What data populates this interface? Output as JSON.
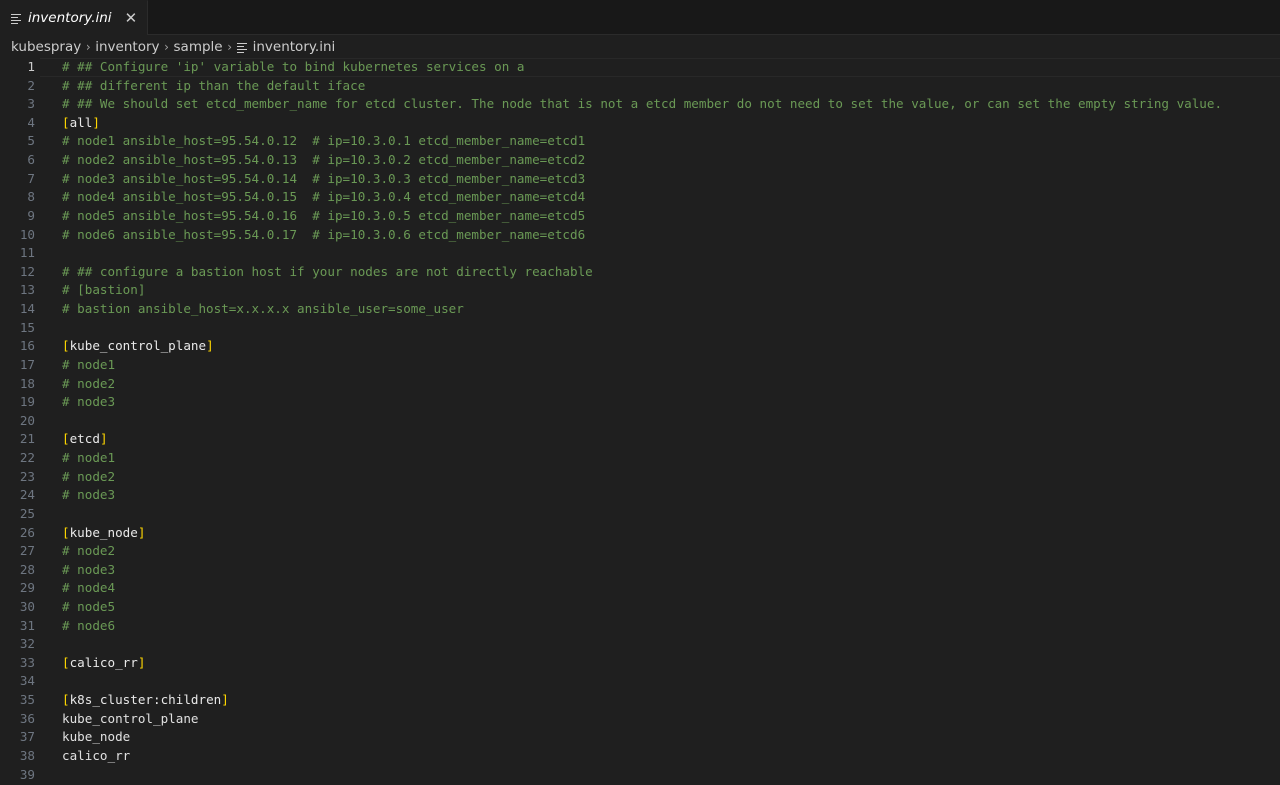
{
  "tab": {
    "label": "inventory.ini",
    "close": "✕",
    "icon": "file-lines-icon"
  },
  "breadcrumb": [
    "kubespray",
    "inventory",
    "sample",
    "inventory.ini"
  ],
  "lines": [
    {
      "n": "1",
      "kind": "comment",
      "text": "# ## Configure 'ip' variable to bind kubernetes services on a"
    },
    {
      "n": "2",
      "kind": "comment",
      "text": "# ## different ip than the default iface"
    },
    {
      "n": "3",
      "kind": "comment",
      "text": "# ## We should set etcd_member_name for etcd cluster. The node that is not a etcd member do not need to set the value, or can set the empty string value."
    },
    {
      "n": "4",
      "kind": "section",
      "text": "all"
    },
    {
      "n": "5",
      "kind": "comment",
      "text": "# node1 ansible_host=95.54.0.12  # ip=10.3.0.1 etcd_member_name=etcd1"
    },
    {
      "n": "6",
      "kind": "comment",
      "text": "# node2 ansible_host=95.54.0.13  # ip=10.3.0.2 etcd_member_name=etcd2"
    },
    {
      "n": "7",
      "kind": "comment",
      "text": "# node3 ansible_host=95.54.0.14  # ip=10.3.0.3 etcd_member_name=etcd3"
    },
    {
      "n": "8",
      "kind": "comment",
      "text": "# node4 ansible_host=95.54.0.15  # ip=10.3.0.4 etcd_member_name=etcd4"
    },
    {
      "n": "9",
      "kind": "comment",
      "text": "# node5 ansible_host=95.54.0.16  # ip=10.3.0.5 etcd_member_name=etcd5"
    },
    {
      "n": "10",
      "kind": "comment",
      "text": "# node6 ansible_host=95.54.0.17  # ip=10.3.0.6 etcd_member_name=etcd6"
    },
    {
      "n": "11",
      "kind": "blank",
      "text": ""
    },
    {
      "n": "12",
      "kind": "comment",
      "text": "# ## configure a bastion host if your nodes are not directly reachable"
    },
    {
      "n": "13",
      "kind": "comment",
      "text": "# [bastion]"
    },
    {
      "n": "14",
      "kind": "comment",
      "text": "# bastion ansible_host=x.x.x.x ansible_user=some_user"
    },
    {
      "n": "15",
      "kind": "blank",
      "text": ""
    },
    {
      "n": "16",
      "kind": "section",
      "text": "kube_control_plane"
    },
    {
      "n": "17",
      "kind": "comment",
      "text": "# node1"
    },
    {
      "n": "18",
      "kind": "comment",
      "text": "# node2"
    },
    {
      "n": "19",
      "kind": "comment",
      "text": "# node3"
    },
    {
      "n": "20",
      "kind": "blank",
      "text": ""
    },
    {
      "n": "21",
      "kind": "section",
      "text": "etcd"
    },
    {
      "n": "22",
      "kind": "comment",
      "text": "# node1"
    },
    {
      "n": "23",
      "kind": "comment",
      "text": "# node2"
    },
    {
      "n": "24",
      "kind": "comment",
      "text": "# node3"
    },
    {
      "n": "25",
      "kind": "blank",
      "text": ""
    },
    {
      "n": "26",
      "kind": "section",
      "text": "kube_node"
    },
    {
      "n": "27",
      "kind": "comment",
      "text": "# node2"
    },
    {
      "n": "28",
      "kind": "comment",
      "text": "# node3"
    },
    {
      "n": "29",
      "kind": "comment",
      "text": "# node4"
    },
    {
      "n": "30",
      "kind": "comment",
      "text": "# node5"
    },
    {
      "n": "31",
      "kind": "comment",
      "text": "# node6"
    },
    {
      "n": "32",
      "kind": "blank",
      "text": ""
    },
    {
      "n": "33",
      "kind": "section",
      "text": "calico_rr"
    },
    {
      "n": "34",
      "kind": "blank",
      "text": ""
    },
    {
      "n": "35",
      "kind": "section",
      "text": "k8s_cluster:children"
    },
    {
      "n": "36",
      "kind": "plain",
      "text": "kube_control_plane"
    },
    {
      "n": "37",
      "kind": "plain",
      "text": "kube_node"
    },
    {
      "n": "38",
      "kind": "plain",
      "text": "calico_rr"
    },
    {
      "n": "39",
      "kind": "blank",
      "text": ""
    }
  ],
  "current_line": "1",
  "colors": {
    "comment": "#6a9955",
    "bracket": "#ffd700",
    "background": "#1f1f1f"
  }
}
